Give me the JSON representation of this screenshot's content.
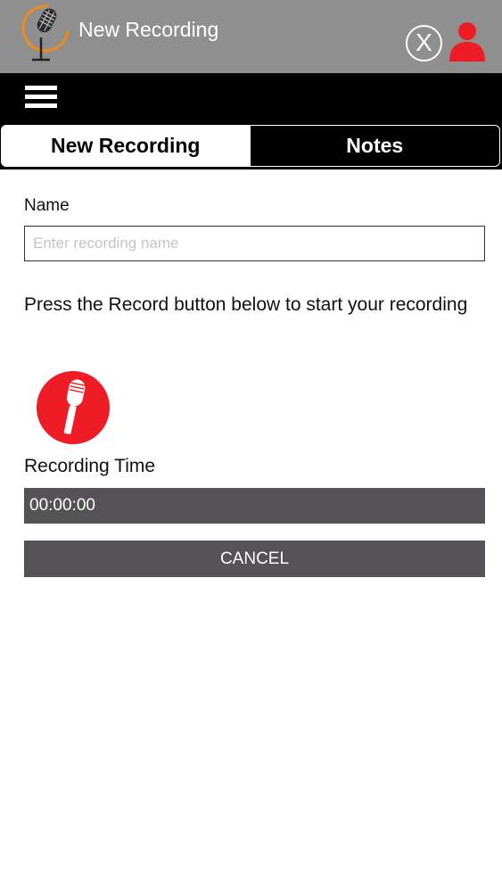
{
  "header": {
    "title": "New Recording",
    "close_icon": "close-circle-icon",
    "user_icon": "user-icon",
    "logo_icon": "microphone-logo-icon"
  },
  "menu": {
    "icon": "hamburger-menu-icon"
  },
  "tabs": [
    {
      "label": "New Recording",
      "active": true
    },
    {
      "label": "Notes",
      "active": false
    }
  ],
  "form": {
    "name_label": "Name",
    "name_value": "",
    "name_placeholder": "Enter recording name",
    "instructions": "Press the Record button below to start your recording",
    "record_icon": "record-microphone-icon",
    "time_label": "Recording Time",
    "time_value": "00:00:00",
    "cancel_label": "CANCEL"
  },
  "colors": {
    "titlebar": "#8f8f8f",
    "menubar": "#000000",
    "accent_red": "#ee1c24",
    "logo_ring": "#f08a1c",
    "dark_button": "#555355"
  }
}
